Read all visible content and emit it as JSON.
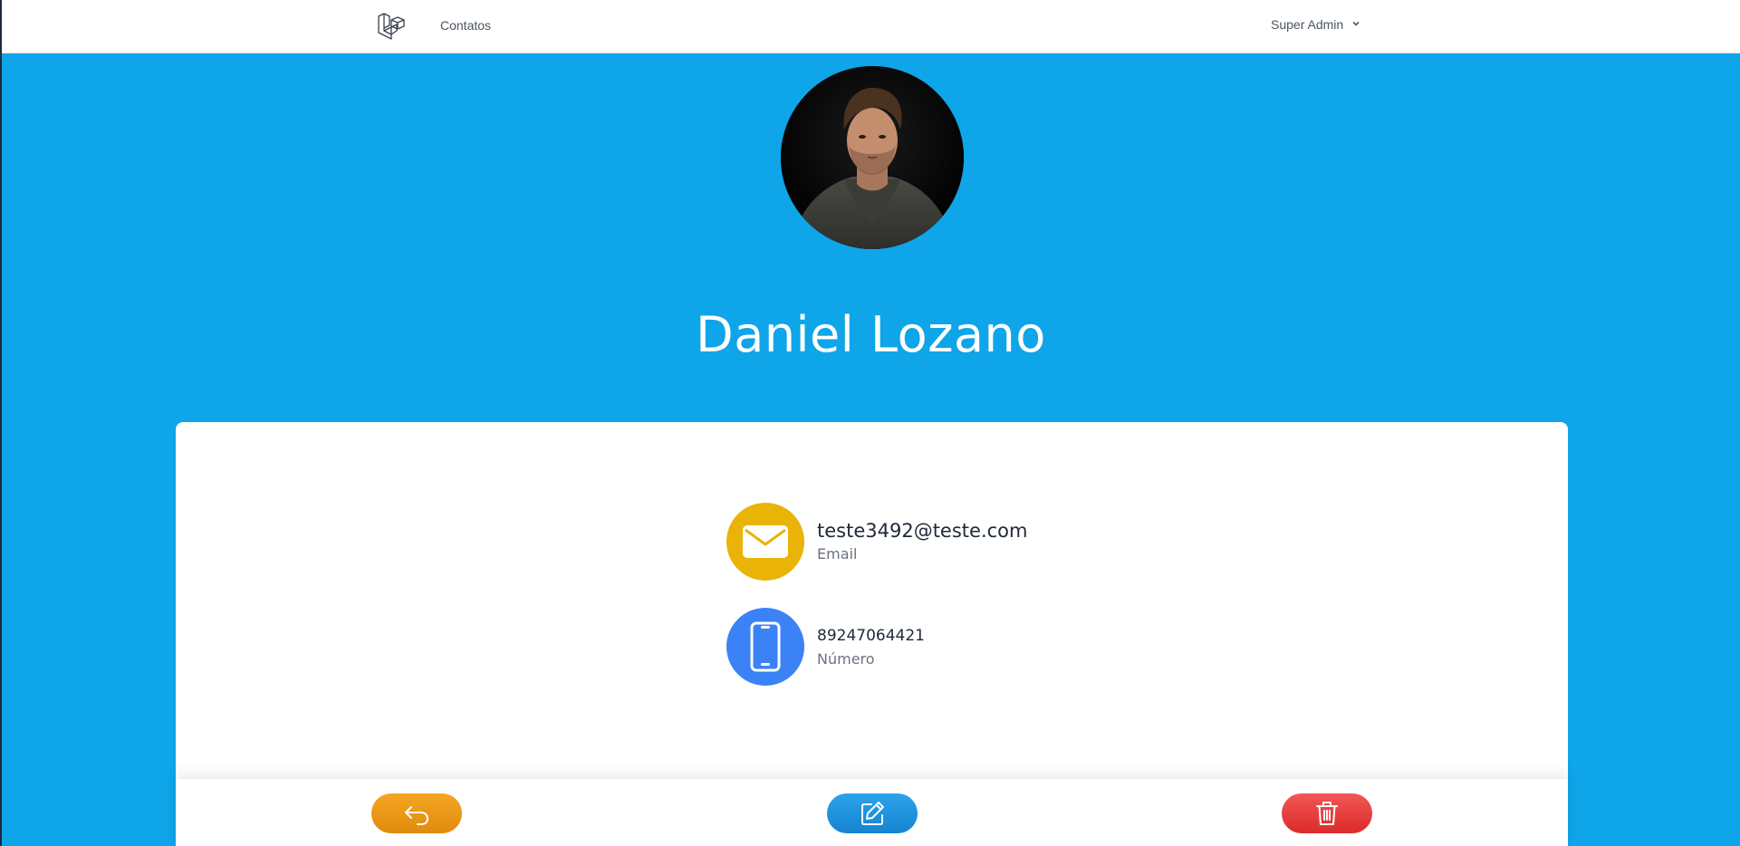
{
  "nav": {
    "contacts_link": "Contatos",
    "user_name": "Super Admin"
  },
  "contact": {
    "name": "Daniel Lozano",
    "email": {
      "value": "teste3492@teste.com",
      "label": "Email",
      "icon": "envelope-icon",
      "color": "#eab308"
    },
    "phone": {
      "value": "89247064421",
      "label": "Número",
      "icon": "smartphone-icon",
      "color": "#3b82f6"
    }
  },
  "actions": {
    "back_icon": "undo-arrow-icon",
    "edit_icon": "pencil-square-icon",
    "delete_icon": "trash-icon",
    "back_color": "#f59e0b",
    "edit_color": "#1e95df",
    "delete_color": "#ef4444"
  },
  "theme": {
    "background": "#0ea5e9",
    "card": "#ffffff"
  }
}
